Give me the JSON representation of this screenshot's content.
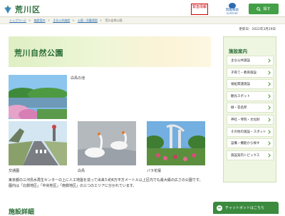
{
  "header": {
    "city_name": "荒川区",
    "emergency_label": "緊急情報",
    "support_label": "閲覧補助",
    "support_sub": "SUPPORT",
    "search_label": "探す"
  },
  "breadcrumb": [
    "トップページ",
    "施設案内",
    "主な公共施設",
    "公園・児童遊園",
    "荒川自然公園"
  ],
  "updated": "更新日：2022年3月29日",
  "page": {
    "title": "荒川自然公園",
    "photos": [
      {
        "caption": "白鳥の池",
        "icon": "pond-photo"
      },
      {
        "caption": "交通園",
        "icon": "traffic-park-photo"
      },
      {
        "caption": "白鳥",
        "icon": "swan-photo"
      },
      {
        "caption": "バラ花壇",
        "icon": "rose-garden-photo"
      }
    ],
    "description_1": "東京都の三河島水再生センターの上に人工地盤を造って出来た約6万平方メートル以上区内でも最大級の広さの公園です。",
    "description_2": "園内は「北側地区」「中央地区」「南側地区」の三つのエリアに分かれています。",
    "section_heading": "施設詳細"
  },
  "sidebar": {
    "title": "施設案内",
    "items": [
      "主な公共施設",
      "子育て・教育施設",
      "福祉関連施設",
      "観光スポット",
      "緑・花名所",
      "神社・寺院・文化財",
      "その他の施設・スポット",
      "設備・機能から探す",
      "施設案内トピックス"
    ]
  },
  "chatbot": {
    "label": "チャットボットはこちら"
  }
}
